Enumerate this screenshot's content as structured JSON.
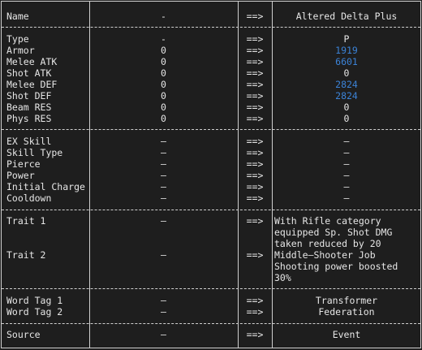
{
  "header": {
    "name_label": "Name",
    "from": "-",
    "arrow": "==>",
    "to": "Altered Delta Plus"
  },
  "stats": [
    {
      "label": "Type",
      "from": "-",
      "arrow": "==>",
      "to": "P"
    },
    {
      "label": "Armor",
      "from": "0",
      "arrow": "==>",
      "to": "1919",
      "to_color": "#3b82d6"
    },
    {
      "label": "Melee ATK",
      "from": "0",
      "arrow": "==>",
      "to": "6601",
      "to_color": "#3b82d6"
    },
    {
      "label": "Shot ATK",
      "from": "0",
      "arrow": "==>",
      "to": "0"
    },
    {
      "label": "Melee DEF",
      "from": "0",
      "arrow": "==>",
      "to": "2824",
      "to_color": "#3b82d6"
    },
    {
      "label": "Shot DEF",
      "from": "0",
      "arrow": "==>",
      "to": "2824",
      "to_color": "#3b82d6"
    },
    {
      "label": "Beam RES",
      "from": "0",
      "arrow": "==>",
      "to": "0"
    },
    {
      "label": "Phys RES",
      "from": "0",
      "arrow": "==>",
      "to": "0"
    }
  ],
  "skills": [
    {
      "label": "EX Skill",
      "from": "–",
      "arrow": "==>",
      "to": "–"
    },
    {
      "label": "Skill Type",
      "from": "–",
      "arrow": "==>",
      "to": "–"
    },
    {
      "label": "Pierce",
      "from": "–",
      "arrow": "==>",
      "to": "–"
    },
    {
      "label": "Power",
      "from": "–",
      "arrow": "==>",
      "to": "–"
    },
    {
      "label": "Initial Charge",
      "from": "–",
      "arrow": "==>",
      "to": "–"
    },
    {
      "label": "Cooldown",
      "from": "–",
      "arrow": "==>",
      "to": "–"
    }
  ],
  "traits": [
    {
      "label": "Trait 1",
      "from": "–",
      "arrow": "==>",
      "to": "With Rifle category equipped Sp. Shot DMG taken reduced by 20"
    },
    {
      "label": "Trait 2",
      "from": "–",
      "arrow": "==>",
      "to": "Middle–Shooter Job Shooting power boosted 30%"
    }
  ],
  "tags": [
    {
      "label": "Word Tag 1",
      "from": "–",
      "arrow": "==>",
      "to": "Transformer"
    },
    {
      "label": "Word Tag 2",
      "from": "–",
      "arrow": "==>",
      "to": "Federation"
    }
  ],
  "source": {
    "label": "Source",
    "from": "–",
    "arrow": "==>",
    "to": "Event"
  }
}
